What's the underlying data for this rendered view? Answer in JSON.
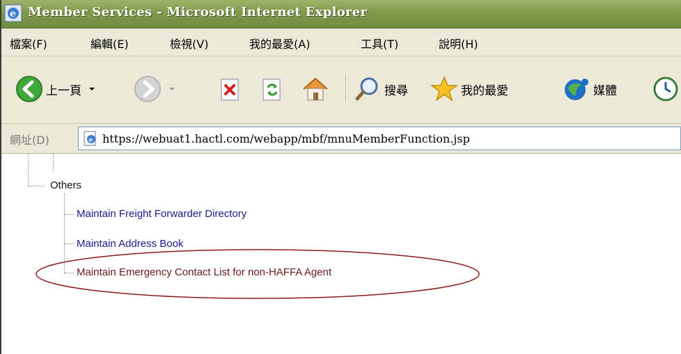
{
  "window": {
    "title": "Member Services - Microsoft Internet Explorer"
  },
  "menu": {
    "items": [
      {
        "label": "檔案(F)"
      },
      {
        "label": "編輯(E)"
      },
      {
        "label": "檢視(V)"
      },
      {
        "label": "我的最愛(A)"
      },
      {
        "label": "工具(T)"
      },
      {
        "label": "說明(H)"
      }
    ]
  },
  "toolbar": {
    "back_label": "上一頁",
    "search_label": "搜尋",
    "favorites_label": "我的最愛",
    "media_label": "媒體"
  },
  "address": {
    "label": "網址(D)",
    "url": "https://webuat1.hactl.com/webapp/mbf/mnuMemberFunction.jsp"
  },
  "tree": {
    "group_label": "Others",
    "items": [
      {
        "label": "Maintain Freight Forwarder Directory"
      },
      {
        "label": "Maintain Address Book"
      },
      {
        "label": "Maintain Emergency Contact List for non-HAFFA Agent"
      }
    ]
  },
  "colors": {
    "titlebar": "#7f9a4a",
    "link": "#1a1a8c",
    "highlight_ellipse": "#8b1a1a"
  }
}
